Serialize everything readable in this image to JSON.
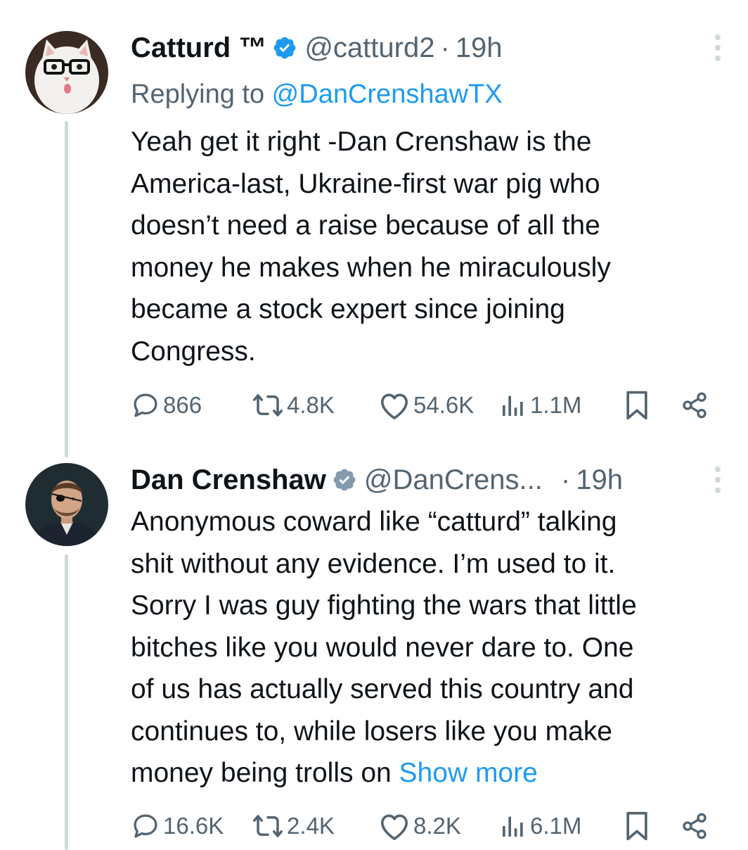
{
  "tweets": [
    {
      "name": "Catturd ™",
      "handle": "@catturd2",
      "separator": "·",
      "time": "19h",
      "replying_prefix": "Replying to ",
      "replying_to": "@DanCrenshawTX",
      "text": "Yeah get it right -Dan Crenshaw is the\nAmerica-last, Ukraine-first war pig who\ndoesn’t need a raise because of all the\nmoney he makes when he miraculously\nbecame a stock expert since joining\nCongress.",
      "avatar_icon": "cat-with-glasses-avatar",
      "stats": {
        "replies": "866",
        "reposts": "4.8K",
        "likes": "54.6K",
        "views": "1.1M"
      }
    },
    {
      "name": "Dan Crenshaw",
      "handle": "@DanCrens...",
      "separator": "·",
      "time": "19h",
      "text": "Anonymous coward like “catturd” talking\nshit without any evidence. I’m used to it.\nSorry I was guy fighting the wars that little\nbitches like you would never dare to. One\nof us has actually served this country and\ncontinues to, while losers like you make\nmoney being trolls on ",
      "show_more": "Show more",
      "avatar_icon": "man-with-eyepatch-avatar",
      "stats": {
        "replies": "16.6K",
        "reposts": "2.4K",
        "likes": "8.2K",
        "views": "6.1M"
      }
    }
  ],
  "colors": {
    "verified_blue": "#1d9bf0",
    "verified_gray": "#829aab",
    "link": "#1d9bf0",
    "secondary_text": "#536471",
    "primary_text": "#0f1419"
  }
}
